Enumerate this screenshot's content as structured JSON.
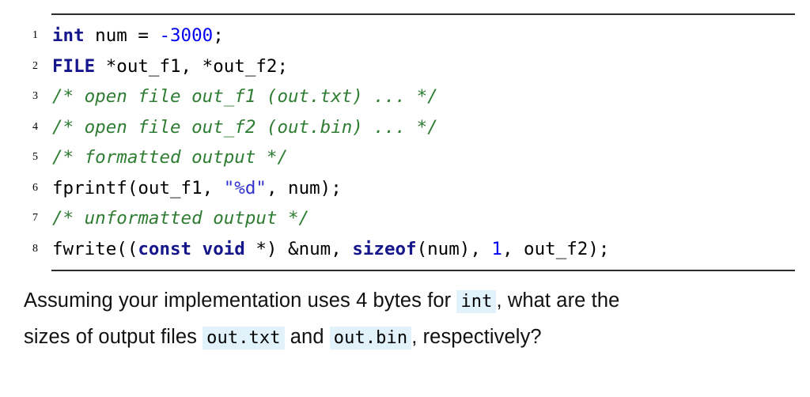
{
  "slide": {
    "background_color": "#ffffff",
    "rule_color": "#2b2b2b"
  },
  "colors": {
    "keyword": "#16168c",
    "number": "#0000ee",
    "string": "#3333cc",
    "comment": "#2e7d32",
    "plain": "#000000",
    "inline_code_background": "#e2f2fb"
  },
  "listing": {
    "language": "C",
    "lines": [
      {
        "number": "1",
        "tokens": [
          {
            "text": "int",
            "type": "kw"
          },
          {
            "text": " num = ",
            "type": "pl"
          },
          {
            "text": "-3000",
            "type": "num"
          },
          {
            "text": ";",
            "type": "pl"
          }
        ],
        "plain_text": "int num = -3000;"
      },
      {
        "number": "2",
        "tokens": [
          {
            "text": "FILE",
            "type": "kw"
          },
          {
            "text": " *out_f1, *out_f2;",
            "type": "pl"
          }
        ],
        "plain_text": "FILE *out_f1, *out_f2;"
      },
      {
        "number": "3",
        "tokens": [
          {
            "text": "/* open file out_f1 (out.txt) ... */",
            "type": "cmt"
          }
        ],
        "plain_text": "/* open file out_f1 (out.txt) ... */"
      },
      {
        "number": "4",
        "tokens": [
          {
            "text": "/* open file out_f2 (out.bin) ... */",
            "type": "cmt"
          }
        ],
        "plain_text": "/* open file out_f2 (out.bin) ... */"
      },
      {
        "number": "5",
        "tokens": [
          {
            "text": "/* formatted output */",
            "type": "cmt"
          }
        ],
        "plain_text": "/* formatted output */"
      },
      {
        "number": "6",
        "tokens": [
          {
            "text": "fprintf(out_f1, ",
            "type": "pl"
          },
          {
            "text": "\"%d\"",
            "type": "str"
          },
          {
            "text": ", num);",
            "type": "pl"
          }
        ],
        "plain_text": "fprintf(out_f1, \"%d\", num);"
      },
      {
        "number": "7",
        "tokens": [
          {
            "text": "/* unformatted output */",
            "type": "cmt"
          }
        ],
        "plain_text": "/* unformatted output */"
      },
      {
        "number": "8",
        "tokens": [
          {
            "text": "fwrite((",
            "type": "pl"
          },
          {
            "text": "const void",
            "type": "kw"
          },
          {
            "text": " *) &num, ",
            "type": "pl"
          },
          {
            "text": "sizeof",
            "type": "kw"
          },
          {
            "text": "(num), ",
            "type": "pl"
          },
          {
            "text": "1",
            "type": "num"
          },
          {
            "text": ", out_f2);",
            "type": "pl"
          }
        ],
        "plain_text": "fwrite((const void *) &num, sizeof(num), 1, out_f2);"
      }
    ]
  },
  "question": {
    "line1": [
      {
        "text": "Assuming your implementation uses 4 bytes for ",
        "type": "text"
      },
      {
        "text": "int",
        "type": "code"
      },
      {
        "text": ", what are the",
        "type": "text"
      }
    ],
    "line2": [
      {
        "text": "sizes of output files ",
        "type": "text"
      },
      {
        "text": "out.txt",
        "type": "code"
      },
      {
        "text": " and ",
        "type": "text"
      },
      {
        "text": "out.bin",
        "type": "code"
      },
      {
        "text": ", respectively?",
        "type": "text"
      }
    ],
    "full_text": "Assuming your implementation uses 4 bytes for int, what are the sizes of output files out.txt and out.bin, respectively?"
  }
}
